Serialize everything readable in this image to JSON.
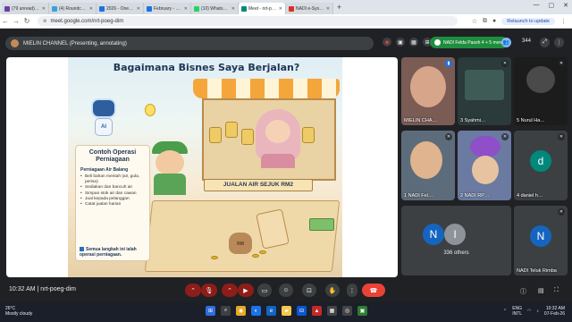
{
  "browser": {
    "tabs": [
      {
        "label": "(79 unread) - mohdfo…",
        "color": "#6b3fa0"
      },
      {
        "label": "(4) Roundcube Webm…",
        "color": "#37a3d9"
      },
      {
        "label": "2026 - OneDrive",
        "color": "#1a73e8"
      },
      {
        "label": "February - OneDrive",
        "color": "#1a73e8"
      },
      {
        "label": "(10) WhatsApp",
        "color": "#25d366"
      },
      {
        "label": "Meet - nrt-poeg-…",
        "color": "#00897b"
      },
      {
        "label": "NADI e-System",
        "color": "#d93025"
      }
    ],
    "url": "meet.google.com/nrt-poeg-dim",
    "relaunch_label": "Relaunch to update"
  },
  "meet": {
    "presenting_label": "MIELIN CHANNEL (Presenting, annotating)",
    "pill_label": "NADI Felda Pasoh 4 + 5 more",
    "participant_count": "344",
    "meeting_time": "10:32 AM",
    "meeting_code": "nrt-poeg-dim"
  },
  "slide": {
    "title": "Bagaimana Bisnes Saya Berjalan?",
    "card_title": "Contoh Operasi Perniagaan",
    "card_subtitle": "Perniagaan Air Balang",
    "bullets": [
      "Beli bahan mentah (air, gula, perisa)",
      "Sediakan dan bancuh air",
      "Simpan stok air dan cawan",
      "Jual kepada pelanggan",
      "Catat jualan harian"
    ],
    "footnote": "Semua langkah ini ialah operasi perniagaan.",
    "sign_text": "JUALAN AIR SEJUK RM2",
    "robot_label": "AI",
    "bag_label": "RM"
  },
  "tiles": [
    {
      "name": "MIELIN CHA…",
      "kind": "video"
    },
    {
      "name": "Syahmi…",
      "num": "3",
      "kind": "video"
    },
    {
      "name": "Nurul Ha…",
      "num": "5",
      "kind": "video"
    },
    {
      "name": "NADI Fel…",
      "num": "1",
      "kind": "video"
    },
    {
      "name": "NADI RP…",
      "num": "2",
      "kind": "video"
    },
    {
      "name": "daniel h…",
      "num": "4",
      "kind": "avatar",
      "letter": "d",
      "color": "#00897b"
    },
    {
      "name": "336 others",
      "kind": "others",
      "letters": [
        "N",
        "I"
      ]
    },
    {
      "name": "NADI Teluk Rimba",
      "kind": "avatar",
      "letter": "N",
      "color": "#1565c0"
    }
  ],
  "taskbar": {
    "temp": "26°C",
    "weather": "Mostly cloudy",
    "lang": "ENG",
    "region": "INTL",
    "clock": "10:32 AM",
    "date": "07-Feb-26"
  },
  "colors": {
    "meet_bg": "#202124",
    "end_call": "#ea4335",
    "mic_off": "#8c1d18",
    "accent_green": "#1e8e3e"
  }
}
